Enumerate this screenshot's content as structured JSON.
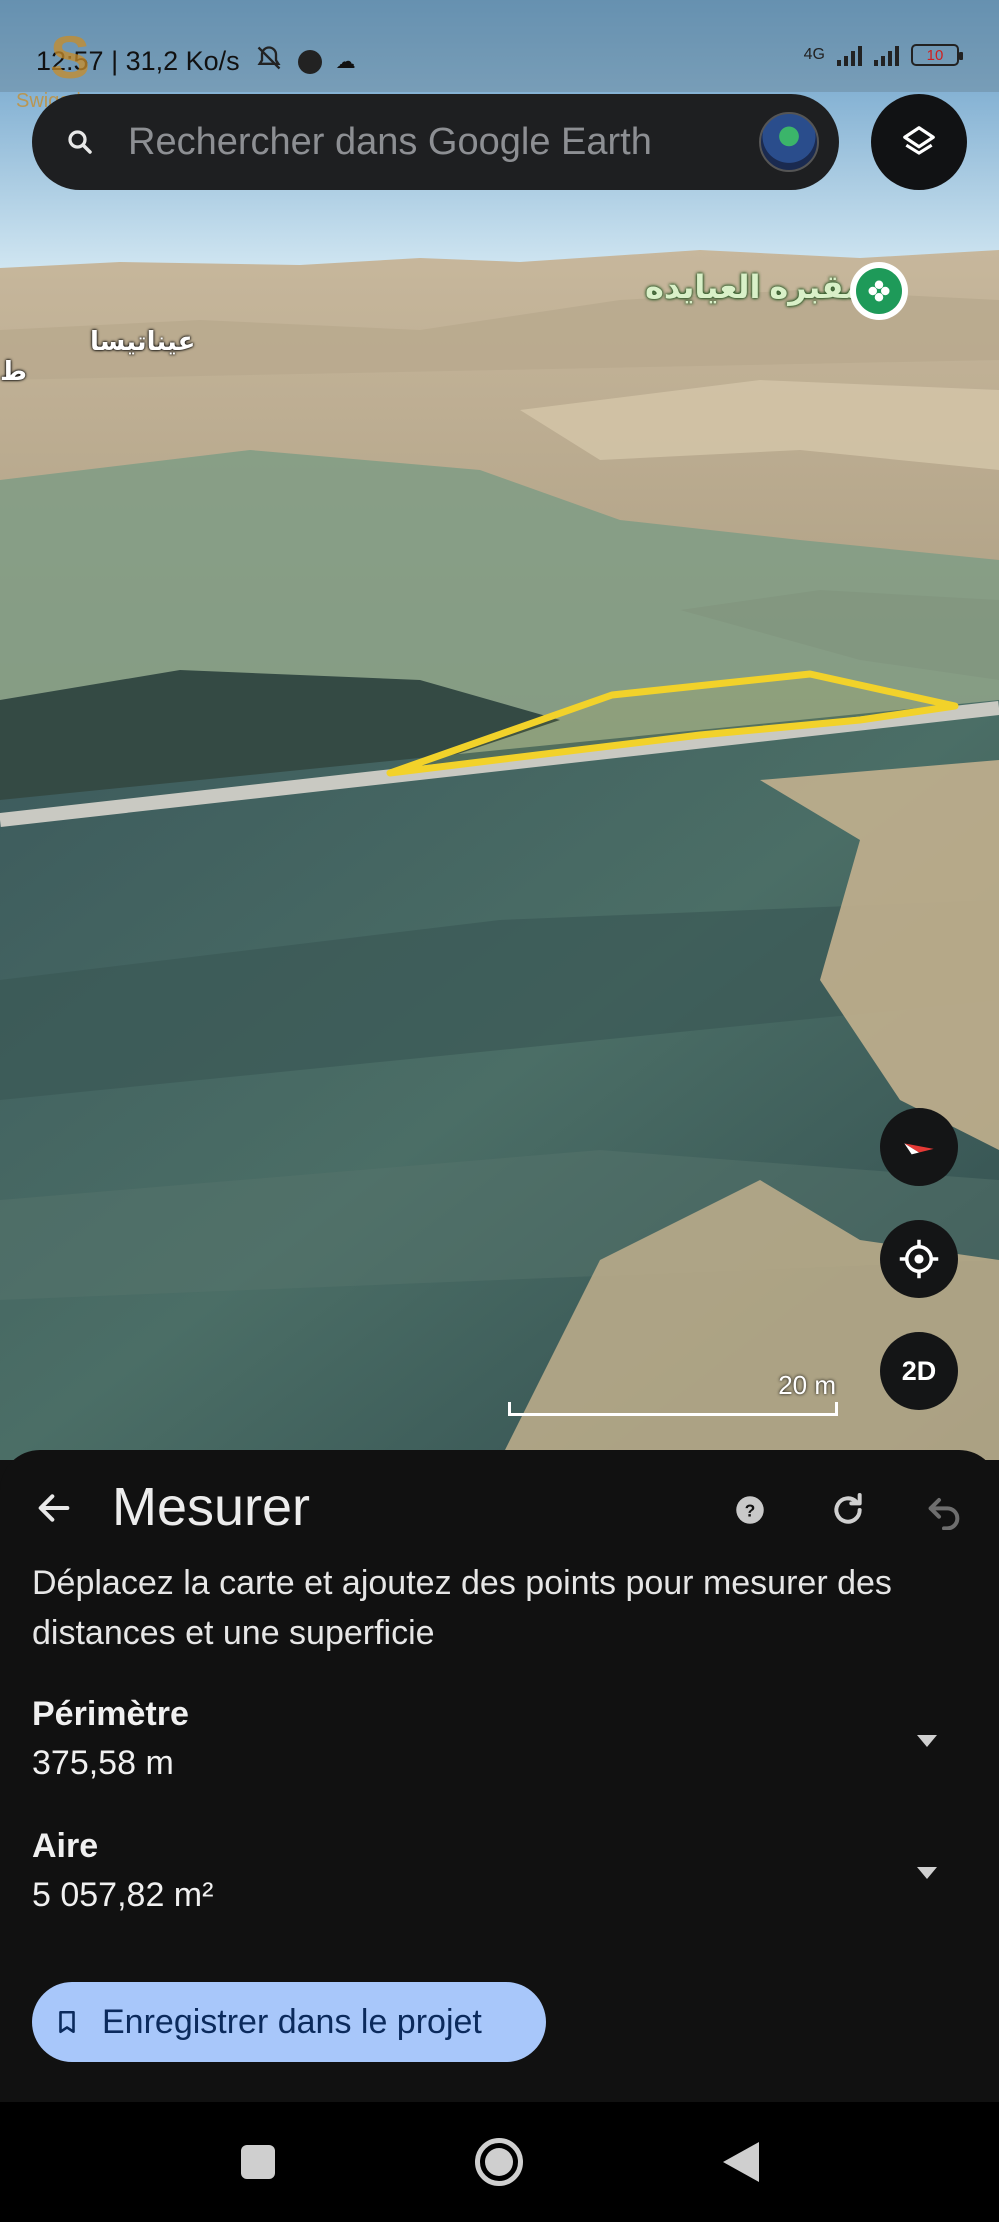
{
  "status_bar": {
    "time_speed": "12:57 | 31,2 Ko/s",
    "network": "4G",
    "battery": "10"
  },
  "watermark": {
    "text": "Swiga | سويقة",
    "logo": "S"
  },
  "search": {
    "placeholder": "Rechercher dans Google Earth"
  },
  "map": {
    "labels": {
      "place_green": "مقبره العيايده",
      "place_left": "عيناتيسا",
      "place_edge": "ط"
    },
    "scale_label": "20 m",
    "mode_button": "2D",
    "polygon_color": "#f2d22a"
  },
  "sheet": {
    "title": "Mesurer",
    "instructions": "Déplacez la carte et ajoutez des points pour mesurer des distances et une superficie",
    "perimeter": {
      "label": "Périmètre",
      "value": "375,58 m"
    },
    "area": {
      "label": "Aire",
      "value": "5 057,82 m²"
    },
    "save_label": "Enregistrer dans le projet"
  },
  "icons": [
    "search-icon",
    "layers-icon",
    "compass-icon",
    "my-location-icon",
    "back-arrow-icon",
    "help-icon",
    "refresh-icon",
    "undo-icon",
    "dropdown-icon",
    "bookmark-icon"
  ],
  "colors": {
    "accent_button": "#a8c7fa",
    "sheet_bg": "#111111",
    "measure_outline": "#f2d22a",
    "place_marker": "#1e9a59"
  }
}
